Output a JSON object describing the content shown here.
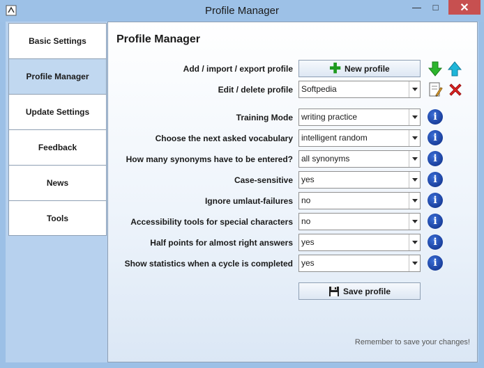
{
  "window": {
    "title": "Profile Manager",
    "minimize": "—",
    "maximize": "□",
    "close": "✕"
  },
  "sidebar": {
    "items": [
      {
        "label": "Basic Settings"
      },
      {
        "label": "Profile Manager"
      },
      {
        "label": "Update Settings"
      },
      {
        "label": "Feedback"
      },
      {
        "label": "News"
      },
      {
        "label": "Tools"
      }
    ]
  },
  "panel": {
    "title": "Profile Manager",
    "add_label": "Add / import / export profile",
    "new_profile_label": "New profile",
    "edit_label": "Edit / delete profile",
    "profile_value": "Softpedia",
    "settings": [
      {
        "label": "Training Mode",
        "value": "writing practice"
      },
      {
        "label": "Choose the next asked vocabulary",
        "value": "intelligent random"
      },
      {
        "label": "How many synonyms have to be entered?",
        "value": "all synonyms"
      },
      {
        "label": "Case-sensitive",
        "value": "yes"
      },
      {
        "label": "Ignore umlaut-failures",
        "value": "no"
      },
      {
        "label": "Accessibility tools for special characters",
        "value": "no"
      },
      {
        "label": "Half points for almost right answers",
        "value": "yes"
      },
      {
        "label": "Show statistics when a cycle is completed",
        "value": "yes"
      }
    ],
    "info_glyph": "i",
    "save_label": "Save profile",
    "footer": "Remember to save your changes!"
  },
  "icons": {
    "import": "green-down-arrow-icon",
    "export": "cyan-up-arrow-icon",
    "edit": "edit-document-icon",
    "delete": "red-x-icon"
  }
}
